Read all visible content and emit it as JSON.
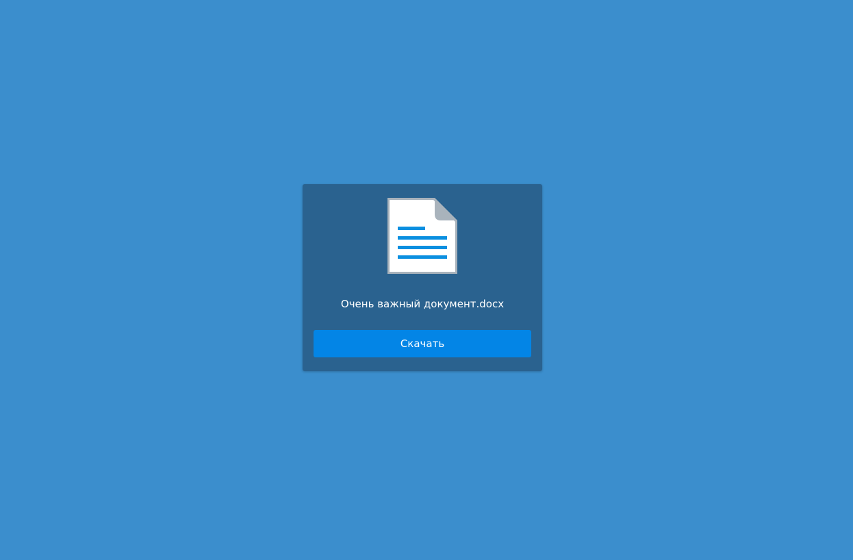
{
  "file": {
    "name": "Очень важный документ.docx",
    "icon": "document-icon"
  },
  "actions": {
    "download_label": "Скачать"
  },
  "colors": {
    "background": "#3b8ecd",
    "card": "#2a628f",
    "button": "#0385e6",
    "icon_lines": "#0a8fe0",
    "icon_border": "#a9b3bc"
  }
}
